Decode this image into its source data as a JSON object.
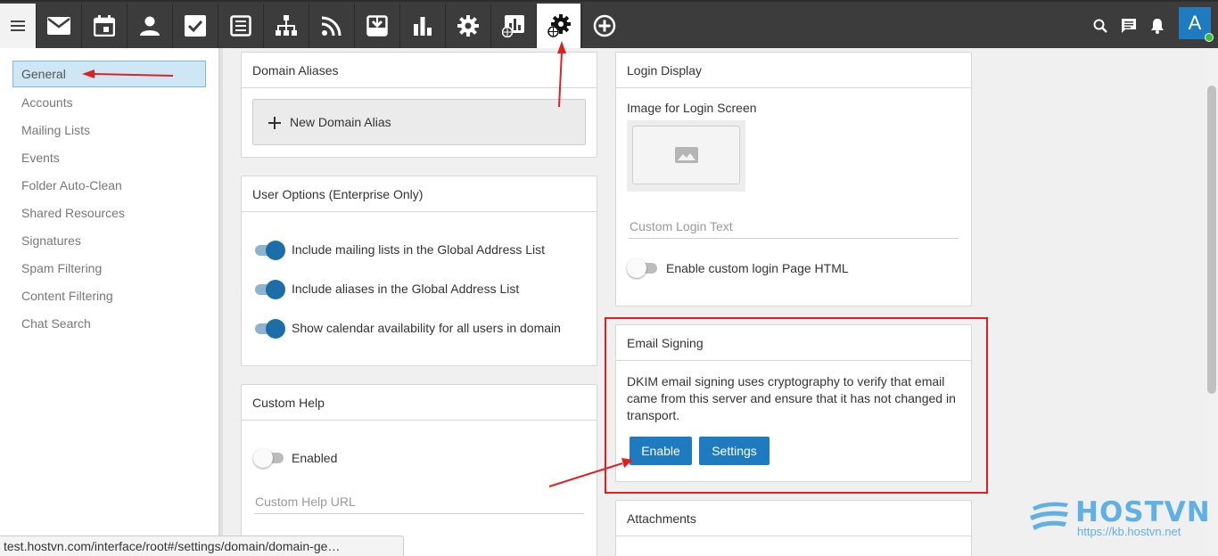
{
  "toolbar": {
    "items": [
      "mail-icon",
      "calendar-icon",
      "contacts-icon",
      "tasks-icon",
      "notes-icon",
      "directory-icon",
      "rss-icon",
      "archive-icon",
      "reports-icon",
      "settings-icon",
      "domain-reports-icon",
      "domain-settings-icon",
      "add-icon"
    ],
    "active": "domain-settings-icon",
    "avatar_letter": "A"
  },
  "sidebar": {
    "items": [
      {
        "label": "General",
        "selected": true
      },
      {
        "label": "Accounts"
      },
      {
        "label": "Mailing Lists"
      },
      {
        "label": "Events"
      },
      {
        "label": "Folder Auto-Clean"
      },
      {
        "label": "Shared Resources"
      },
      {
        "label": "Signatures"
      },
      {
        "label": "Spam Filtering"
      },
      {
        "label": "Content Filtering"
      },
      {
        "label": "Chat Search"
      }
    ]
  },
  "domain_aliases": {
    "title": "Domain Aliases",
    "new_button": "New Domain Alias"
  },
  "user_options": {
    "title": "User Options (Enterprise Only)",
    "options": [
      {
        "label": "Include mailing lists in the Global Address List",
        "on": true
      },
      {
        "label": "Include aliases in the Global Address List",
        "on": true
      },
      {
        "label": "Show calendar availability for all users in domain",
        "on": true
      }
    ]
  },
  "custom_help": {
    "title": "Custom Help",
    "enabled_label": "Enabled",
    "enabled": false,
    "url_placeholder": "Custom Help URL"
  },
  "login_display": {
    "title": "Login Display",
    "image_label": "Image for Login Screen",
    "text_placeholder": "Custom Login Text",
    "html_toggle_label": "Enable custom login Page HTML",
    "html_enabled": false
  },
  "email_signing": {
    "title": "Email Signing",
    "description": "DKIM email signing uses cryptography to verify that email came from this server and ensure that it has not changed in transport.",
    "enable_button": "Enable",
    "settings_button": "Settings"
  },
  "attachments": {
    "title": "Attachments"
  },
  "status_url": "test.hostvn.com/interface/root#/settings/domain/domain-ge…",
  "watermark": {
    "brand": "HOSTVN",
    "url": "https://kb.hostvn.net"
  },
  "colors": {
    "accent": "#1f7bbf",
    "toolbar": "#3c3c3c",
    "annotation": "#e02020"
  }
}
